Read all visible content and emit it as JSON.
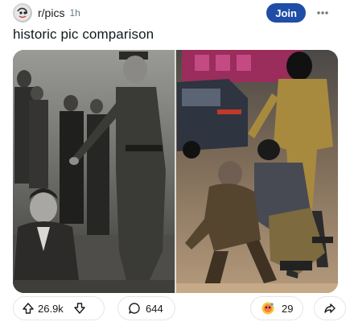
{
  "post": {
    "subreddit": "r/pics",
    "time": "1h",
    "join_label": "Join",
    "title": "historic pic comparison"
  },
  "actions": {
    "upvotes": "26.9k",
    "comments": "644",
    "awards": "29"
  },
  "colors": {
    "join_button": "#1f4da8",
    "text": "#0f1a1c",
    "muted": "#6b7a80",
    "pill_border": "#e3e6e8"
  },
  "icons": [
    "subreddit-avatar-icon",
    "more-options-icon",
    "upvote-icon",
    "downvote-icon",
    "comment-icon",
    "award-icon",
    "share-icon"
  ]
}
